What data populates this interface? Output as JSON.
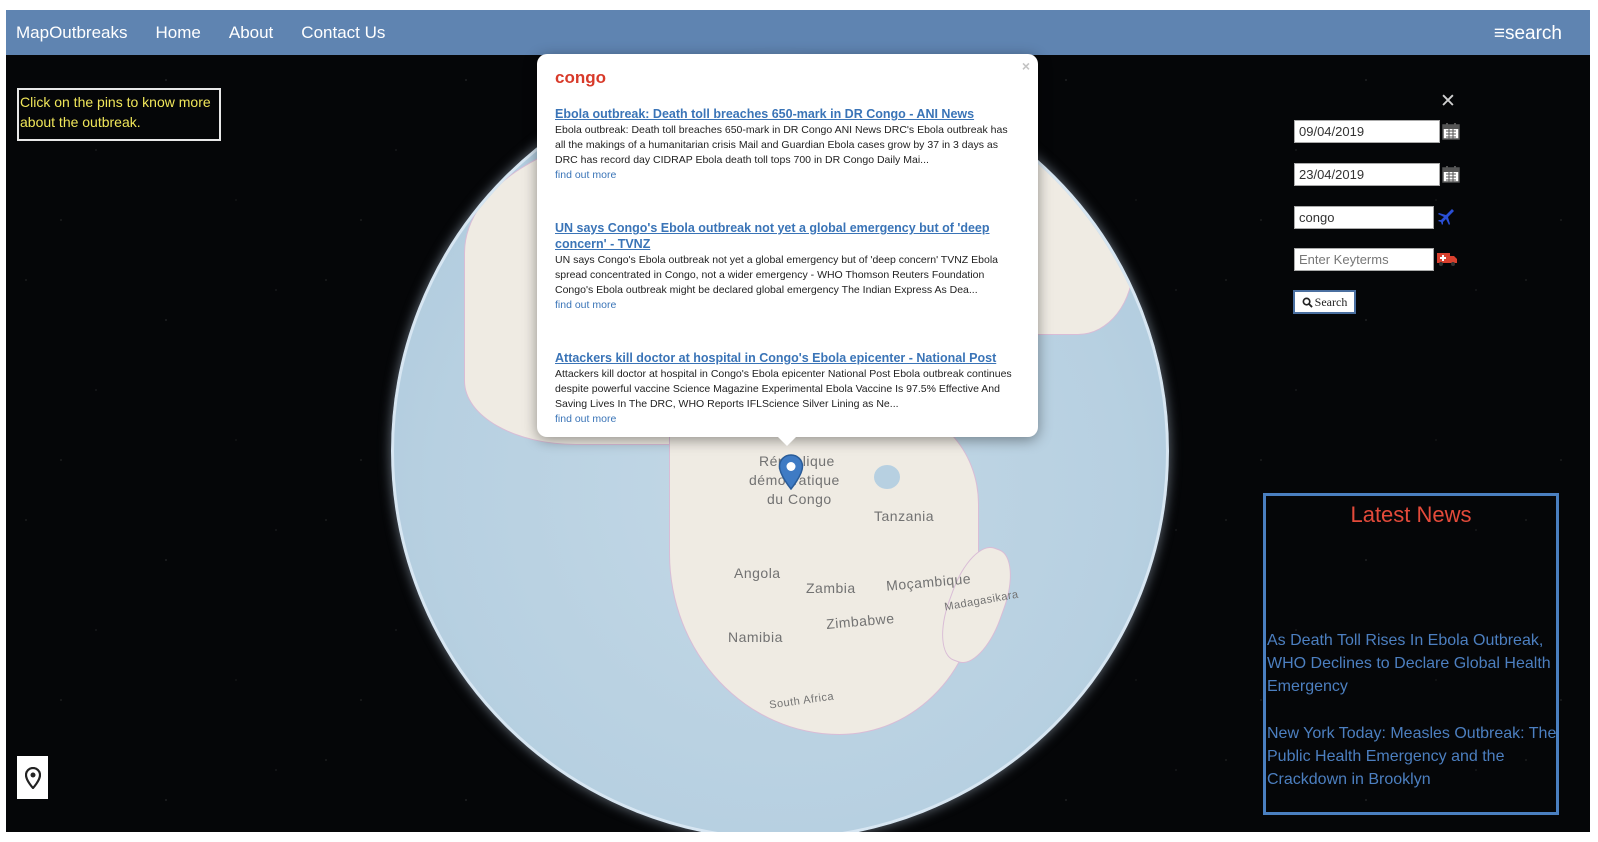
{
  "nav": {
    "brand": "MapOutbreaks",
    "links": [
      "Home",
      "About",
      "Contact Us"
    ],
    "search": "≡search"
  },
  "hint": "Click on the pins to know more about the outbreak.",
  "map": {
    "labels": [
      "République",
      "démocratique",
      "du Congo",
      "Tanzania",
      "Angola",
      "Zambia",
      "Moçambique",
      "Madagasikara",
      "Namibia",
      "Zimbabwe",
      "South Africa"
    ]
  },
  "popup": {
    "title": "congo",
    "close": "×",
    "articles": [
      {
        "title": "Ebola outbreak: Death toll breaches 650-mark in DR Congo - ANI News",
        "desc": "Ebola outbreak: Death toll breaches 650-mark in DR Congo ANI News DRC's Ebola outbreak has all the makings of a humanitarian crisis Mail and Guardian Ebola cases grow by 37 in 3 days as DRC has record day CIDRAP Ebola death toll tops 700 in DR Congo Daily Mai...",
        "more": "find out more"
      },
      {
        "title": "UN says Congo's Ebola outbreak not yet a global emergency but of 'deep concern' - TVNZ",
        "desc": "UN says Congo's Ebola outbreak not yet a global emergency but of 'deep concern' TVNZ Ebola spread concentrated in Congo, not a wider emergency - WHO Thomson Reuters Foundation Congo's Ebola outbreak might be declared global emergency The Indian Express As Dea...",
        "more": "find out more"
      },
      {
        "title": "Attackers kill doctor at hospital in Congo's Ebola epicenter - National Post",
        "desc": "Attackers kill doctor at hospital in Congo's Ebola epicenter National Post Ebola outbreak continues despite powerful vaccine Science Magazine Experimental Ebola Vaccine Is 97.5% Effective And Saving Lives In The DRC, WHO Reports IFLScience Silver Lining as Ne...",
        "more": "find out more"
      }
    ]
  },
  "search_panel": {
    "close": "✕",
    "start_date": "09/04/2019",
    "end_date": "23/04/2019",
    "location": "congo",
    "keyterms_placeholder": "Enter Keyterms",
    "button": "Search"
  },
  "latest_news": {
    "title": "Latest News",
    "items": [
      "As Death Toll Rises In Ebola Outbreak, WHO Declines to Declare Global Health Emergency",
      "New York Today: Measles Outbreak: The Public Health Emergency and the Crackdown in Brooklyn"
    ]
  },
  "colors": {
    "navbar": "#5f84b1",
    "accent_red": "#d83a2a",
    "link_blue": "#3a74b7",
    "hint_yellow": "#f0e65a"
  }
}
